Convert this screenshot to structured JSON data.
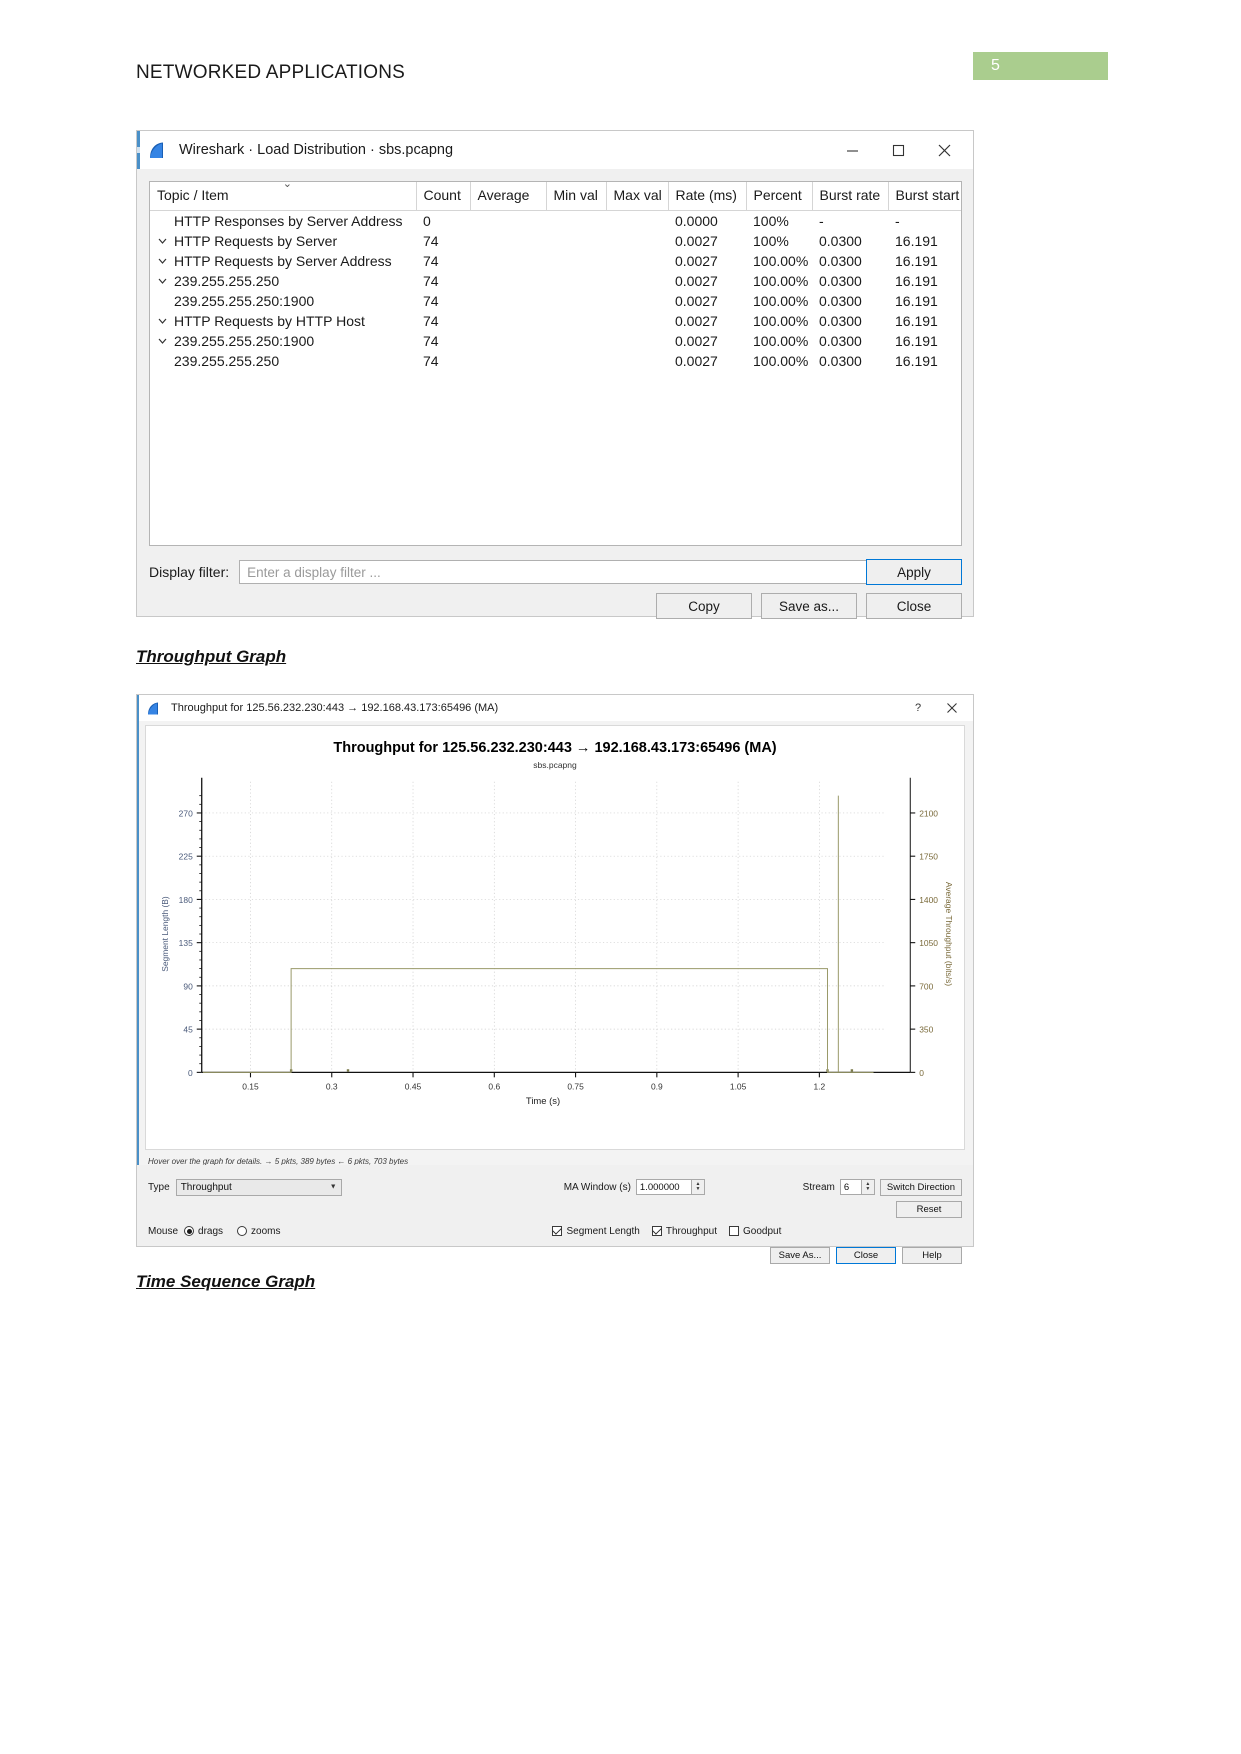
{
  "page": {
    "doc_title": "NETWORKED APPLICATIONS",
    "page_number": "5",
    "accent_green": "#aacd8e",
    "accent_blue": "#0078d7"
  },
  "headings": {
    "throughput_graph": "Throughput Graph",
    "time_sequence_graph": "Time Sequence Graph"
  },
  "load_distribution": {
    "window_title": "Wireshark · Load Distribution · sbs.pcapng",
    "window_buttons": {
      "minimize": "minimize-icon",
      "maximize": "maximize-icon",
      "close": "close-icon"
    },
    "columns": [
      "Topic / Item",
      "Count",
      "Average",
      "Min val",
      "Max val",
      "Rate (ms)",
      "Percent",
      "Burst rate",
      "Burst start"
    ],
    "rows": [
      {
        "indent": 1,
        "twisty": "none",
        "item": "HTTP Responses by Server Address",
        "count": "0",
        "average": "",
        "min_val": "",
        "max_val": "",
        "rate_ms": "0.0000",
        "percent": "100%",
        "burst_rate": "-",
        "burst_start": "-"
      },
      {
        "indent": 0,
        "twisty": "expanded",
        "item": "HTTP Requests by Server",
        "count": "74",
        "average": "",
        "min_val": "",
        "max_val": "",
        "rate_ms": "0.0027",
        "percent": "100%",
        "burst_rate": "0.0300",
        "burst_start": "16.191"
      },
      {
        "indent": 1,
        "twisty": "expanded",
        "item": "HTTP Requests by Server Address",
        "count": "74",
        "average": "",
        "min_val": "",
        "max_val": "",
        "rate_ms": "0.0027",
        "percent": "100.00%",
        "burst_rate": "0.0300",
        "burst_start": "16.191"
      },
      {
        "indent": 2,
        "twisty": "expanded",
        "item": "239.255.255.250",
        "count": "74",
        "average": "",
        "min_val": "",
        "max_val": "",
        "rate_ms": "0.0027",
        "percent": "100.00%",
        "burst_rate": "0.0300",
        "burst_start": "16.191"
      },
      {
        "indent": 3,
        "twisty": "none",
        "item": "239.255.255.250:1900",
        "count": "74",
        "average": "",
        "min_val": "",
        "max_val": "",
        "rate_ms": "0.0027",
        "percent": "100.00%",
        "burst_rate": "0.0300",
        "burst_start": "16.191"
      },
      {
        "indent": 1,
        "twisty": "expanded",
        "item": "HTTP Requests by HTTP Host",
        "count": "74",
        "average": "",
        "min_val": "",
        "max_val": "",
        "rate_ms": "0.0027",
        "percent": "100.00%",
        "burst_rate": "0.0300",
        "burst_start": "16.191"
      },
      {
        "indent": 2,
        "twisty": "expanded",
        "item": "239.255.255.250:1900",
        "count": "74",
        "average": "",
        "min_val": "",
        "max_val": "",
        "rate_ms": "0.0027",
        "percent": "100.00%",
        "burst_rate": "0.0300",
        "burst_start": "16.191"
      },
      {
        "indent": 3,
        "twisty": "none",
        "item": "239.255.255.250",
        "count": "74",
        "average": "",
        "min_val": "",
        "max_val": "",
        "rate_ms": "0.0027",
        "percent": "100.00%",
        "burst_rate": "0.0300",
        "burst_start": "16.191"
      }
    ],
    "filter_label": "Display filter:",
    "filter_value": "",
    "filter_placeholder": "Enter a display filter ...",
    "apply_button": "Apply",
    "copy_button": "Copy",
    "save_as_button": "Save as...",
    "close_button": "Close"
  },
  "throughput_window": {
    "window_title": "Throughput for 125.56.232.230:443 → 192.168.43.173:65496 (MA)",
    "help_button": "?",
    "close_button": "close-icon",
    "hint": "Hover over the graph for details. → 5 pkts, 389 bytes ← 6 pkts, 703 bytes",
    "type_label": "Type",
    "type_value": "Throughput",
    "ma_window_label": "MA Window (s)",
    "ma_window_value": "1.000000",
    "stream_label": "Stream",
    "stream_value": "6",
    "switch_direction_button": "Switch Direction",
    "reset_button": "Reset",
    "mouse_label": "Mouse",
    "mouse_drags": "drags",
    "mouse_zooms": "zooms",
    "mouse_selected": "drags",
    "series_toggles": [
      {
        "label": "Segment Length",
        "checked": true
      },
      {
        "label": "Throughput",
        "checked": true
      },
      {
        "label": "Goodput",
        "checked": false
      }
    ],
    "save_as_button": "Save As...",
    "close_button_label": "Close",
    "help_button_label": "Help"
  },
  "chart_data": {
    "type": "line",
    "title": "Throughput for 125.56.232.230:443 → 192.168.43.173:65496 (MA)",
    "subtitle": "sbs.pcapng",
    "xlabel": "Time (s)",
    "ylabel": "Segment Length (B)",
    "y2label": "Average Throughput (bits/s)",
    "xlim": [
      0.06,
      1.32
    ],
    "ylim": [
      0,
      288
    ],
    "y2lim": [
      0,
      2240
    ],
    "xticks": [
      "0.15",
      "0.3",
      "0.45",
      "0.6",
      "0.75",
      "0.9",
      "1.05",
      "1.2"
    ],
    "xtick_values": [
      0.15,
      0.3,
      0.45,
      0.6,
      0.75,
      0.9,
      1.05,
      1.2
    ],
    "yticks": [
      "0",
      "45",
      "90",
      "135",
      "180",
      "225",
      "270"
    ],
    "ytick_values": [
      0,
      45,
      90,
      135,
      180,
      225,
      270
    ],
    "y2ticks": [
      "0",
      "350",
      "700",
      "1050",
      "1400",
      "1750",
      "2100"
    ],
    "y2tick_values": [
      0,
      350,
      700,
      1050,
      1400,
      1750,
      2100
    ],
    "grid": true,
    "legend": "hidden",
    "series": [
      {
        "name": "Segment Length",
        "color": "#7a7a4a",
        "type": "scatter",
        "points": [
          [
            0.225,
            2
          ],
          [
            0.33,
            2
          ],
          [
            1.215,
            2
          ],
          [
            1.26,
            2
          ]
        ]
      },
      {
        "name": "Throughput",
        "color": "#9a9a6a",
        "type": "step",
        "points": [
          [
            0.062,
            0
          ],
          [
            0.225,
            0
          ],
          [
            0.225,
            108
          ],
          [
            1.215,
            108
          ],
          [
            1.215,
            0
          ],
          [
            1.235,
            0
          ],
          [
            1.235,
            288
          ],
          [
            1.235,
            0
          ],
          [
            1.3,
            0
          ]
        ]
      }
    ]
  }
}
